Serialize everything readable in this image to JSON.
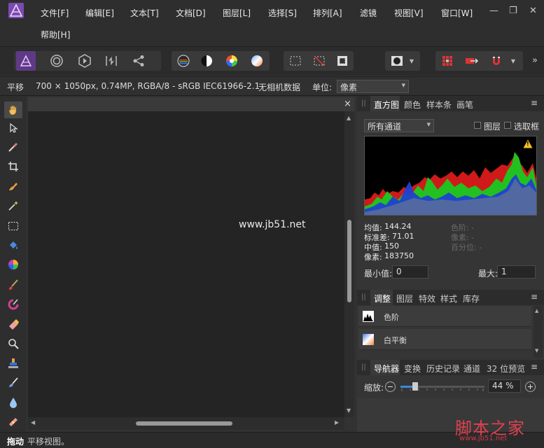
{
  "menubar": {
    "items": [
      "文件[F]",
      "编辑[E]",
      "文本[T]",
      "文档[D]",
      "图层[L]",
      "选择[S]",
      "排列[A]",
      "滤镜",
      "视图[V]",
      "窗口[W]"
    ],
    "help": "帮助[H]",
    "window_controls": {
      "minimize": "—",
      "restore": "❐",
      "close": "✕"
    }
  },
  "toolbar": {
    "overflow": "»"
  },
  "context": {
    "tool_name": "平移",
    "doc_info": "700 × 1050px, 0.74MP, RGBA/8 - sRGB IEC61966-2.1",
    "camera": "无相机数据",
    "unit_label": "单位:",
    "unit_value": "像素"
  },
  "document": {
    "close": "×",
    "watermark": "www.jb51.net"
  },
  "histogram_panel": {
    "tabs": [
      "直方图",
      "颜色",
      "样本条",
      "画笔"
    ],
    "channel": "所有通道",
    "layer_label": "图层",
    "selection_label": "选取框",
    "warning": "!",
    "stats": [
      {
        "label": "均值:",
        "value": "144.24"
      },
      {
        "label": "标准差:",
        "value": "71.01"
      },
      {
        "label": "中值:",
        "value": "150"
      },
      {
        "label": "像素:",
        "value": "183750"
      }
    ],
    "sub_stats": [
      "色阶: -",
      "像素: -",
      "百分位: -"
    ],
    "min_label": "最小值:",
    "min_value": "0",
    "max_label": "最大:",
    "max_value": "1"
  },
  "adjust_panel": {
    "tabs": [
      "调整",
      "图层",
      "特效",
      "样式",
      "库存"
    ],
    "items": [
      "色阶",
      "白平衡"
    ]
  },
  "nav_panel": {
    "tabs": [
      "导航器",
      "变换",
      "历史记录",
      "通道",
      "32 位预览"
    ],
    "zoom_label": "缩放:",
    "zoom_value": "44 %",
    "zoom_fraction": 0.44
  },
  "status": {
    "tool": "拖动",
    "hint": "平移视图。"
  },
  "brand_watermark": {
    "text": "脚本之家",
    "url": "www.jb51.net"
  },
  "colors": {
    "accent": "#3d8bd4",
    "bg": "#323232",
    "canvas": "#242424"
  }
}
